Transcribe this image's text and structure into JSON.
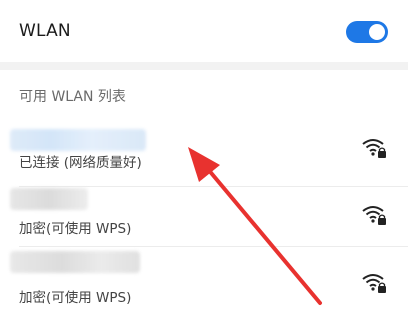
{
  "wlan": {
    "label": "WLAN",
    "enabled": true,
    "toggle_color": "#1e78e6"
  },
  "available_list": {
    "title": "可用 WLAN 列表"
  },
  "networks": [
    {
      "status": "已连接 (网络质量好)",
      "icon": "wifi-locked-icon"
    },
    {
      "status": "加密(可使用 WPS)",
      "icon": "wifi-locked-icon"
    },
    {
      "status": "加密(可使用 WPS)",
      "icon": "wifi-locked-icon"
    }
  ],
  "annotation": {
    "arrow_color": "#e8322f"
  }
}
